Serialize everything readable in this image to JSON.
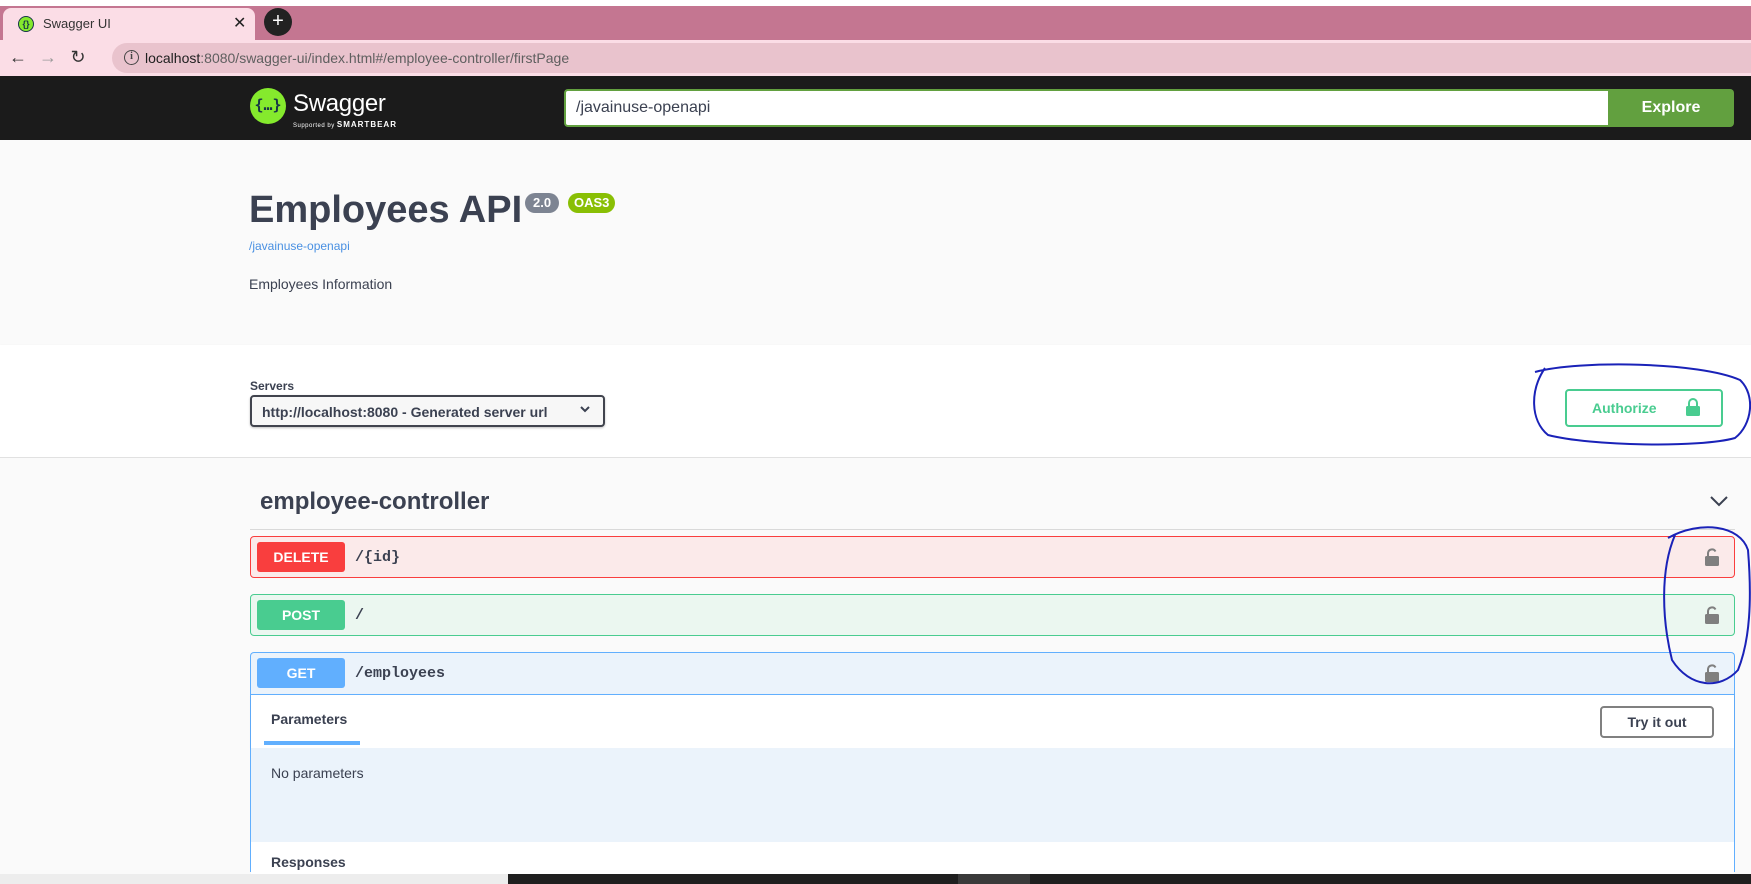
{
  "browser": {
    "tab_title": "Swagger UI",
    "url_host": "localhost",
    "url_rest": ":8080/swagger-ui/index.html#/employee-controller/firstPage"
  },
  "topbar": {
    "logo_text": "Swagger",
    "logo_sub_small": "Supported by",
    "logo_sub_brand": "SMARTBEAR",
    "spec_url": "/javainuse-openapi",
    "explore_label": "Explore"
  },
  "info": {
    "title": "Employees API",
    "version": "2.0",
    "oas_badge": "OAS3",
    "link": "/javainuse-openapi",
    "description": "Employees Information"
  },
  "servers": {
    "label": "Servers",
    "selected": "http://localhost:8080 - Generated server url",
    "authorize_label": "Authorize"
  },
  "tag": {
    "name": "employee-controller"
  },
  "operations": [
    {
      "method": "DELETE",
      "path": "/{id}",
      "color": "#f93e3e"
    },
    {
      "method": "POST",
      "path": "/",
      "color": "#49cc90"
    },
    {
      "method": "GET",
      "path": "/employees",
      "color": "#61affe"
    }
  ],
  "get_details": {
    "parameters_tab": "Parameters",
    "try_it_out": "Try it out",
    "no_parameters": "No parameters",
    "responses": "Responses"
  },
  "icons": [
    "info-icon",
    "swagger-logo-icon",
    "lock-icon",
    "chevron-down-icon"
  ],
  "colors": {
    "topbar_bg": "#1b1b1b",
    "explore_green": "#62a03f",
    "authorize_green": "#49cc90",
    "annotation_blue": "#1a22b8"
  }
}
